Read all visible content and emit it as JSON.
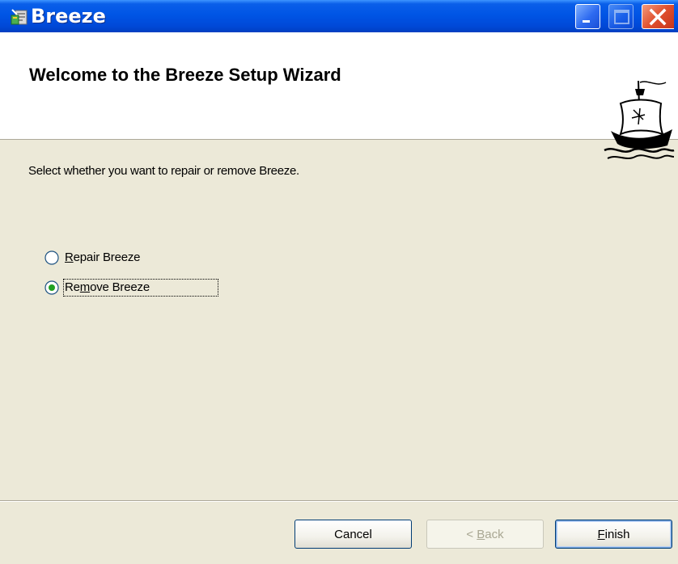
{
  "window": {
    "title": "Breeze",
    "icon": "installer-icon",
    "controls": {
      "minimize": "minimize-icon",
      "maximize": "maximize-icon",
      "close": "close-icon"
    }
  },
  "banner": {
    "title": "Welcome to the Breeze Setup Wizard",
    "logo": "ship-logo"
  },
  "body": {
    "description": "Select whether you want to repair or remove Breeze.",
    "options": [
      {
        "label_first": "R",
        "label_rest": "epair Breeze",
        "selected": false
      },
      {
        "label_pre": "Re",
        "label_u": "m",
        "label_post": "ove Breeze",
        "selected": true
      }
    ]
  },
  "footer": {
    "cancel_label": "Cancel",
    "back_prefix": "< ",
    "back_u": "B",
    "back_rest": "ack",
    "finish_u": "F",
    "finish_rest": "inish"
  },
  "colors": {
    "titlebar": "#0055E5",
    "face": "#ECE9D8",
    "radio_selected": "#21A121",
    "close_button": "#E0502E"
  }
}
